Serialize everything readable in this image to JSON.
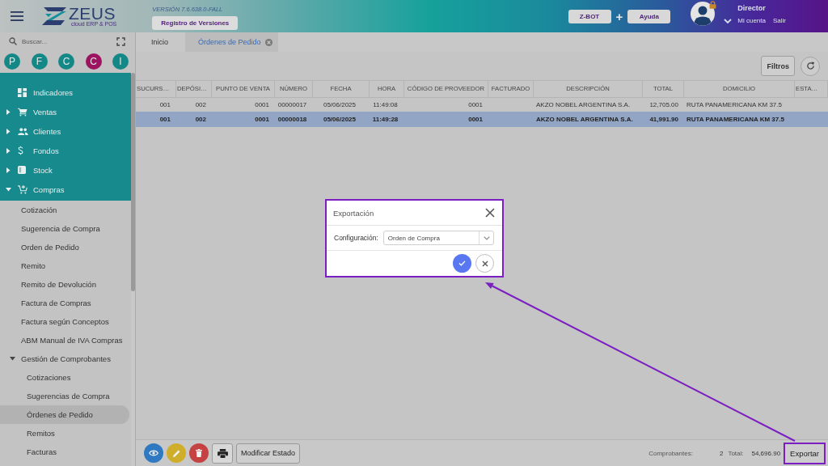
{
  "header": {
    "logo": {
      "name": "ZEUS",
      "tagline": "cloud ERP & POS"
    },
    "version": "VERSIÓN 7.6.638.0-FALL",
    "changelog_button": "Registro de Versiones",
    "zbot_button": "Z-BOT",
    "plus": "+",
    "help_button": "Ayuda",
    "user": {
      "role": "Director",
      "account_link": "Mi cuenta",
      "logout_link": "Salir"
    }
  },
  "sidebar": {
    "search": {
      "placeholder": "Buscar..."
    },
    "shortcuts": [
      {
        "letter": "P",
        "color": "#148886"
      },
      {
        "letter": "F",
        "color": "#148886"
      },
      {
        "letter": "C",
        "color": "#148886"
      },
      {
        "letter": "C",
        "color": "#9c1460"
      },
      {
        "letter": "I",
        "color": "#148886"
      }
    ],
    "menu": [
      {
        "label": "Indicadores",
        "kind": "link"
      },
      {
        "label": "Ventas",
        "kind": "group",
        "expanded": false
      },
      {
        "label": "Clientes",
        "kind": "group",
        "expanded": false
      },
      {
        "label": "Fondos",
        "kind": "group",
        "expanded": false
      },
      {
        "label": "Stock",
        "kind": "group",
        "expanded": false
      },
      {
        "label": "Compras",
        "kind": "group",
        "expanded": true,
        "children": [
          {
            "label": "Cotización",
            "kind": "link",
            "selected": false
          },
          {
            "label": "Sugerencia de Compra",
            "kind": "link",
            "selected": false
          },
          {
            "label": "Orden de Pedido",
            "kind": "link",
            "selected": false
          },
          {
            "label": "Remito",
            "kind": "link",
            "selected": false
          },
          {
            "label": "Remito de Devolución",
            "kind": "link",
            "selected": false
          },
          {
            "label": "Factura de Compras",
            "kind": "link",
            "selected": false
          },
          {
            "label": "Factura según Conceptos",
            "kind": "link",
            "selected": false
          },
          {
            "label": "ABM Manual de IVA Compras",
            "kind": "link",
            "selected": false
          },
          {
            "label": "Gestión de Comprobantes",
            "kind": "group",
            "expanded": true,
            "selected": false,
            "children": [
              {
                "label": "Cotizaciones",
                "selected": false
              },
              {
                "label": "Sugerencias de Compra",
                "selected": false
              },
              {
                "label": "Órdenes de Pedido",
                "selected": true
              },
              {
                "label": "Remitos",
                "selected": false
              },
              {
                "label": "Facturas",
                "selected": false
              }
            ]
          }
        ]
      }
    ]
  },
  "tabs": [
    {
      "label": "Inicio",
      "selected": false,
      "closable": false
    },
    {
      "label": "Órdenes de Pedido",
      "selected": true,
      "closable": true
    }
  ],
  "toolbar": {
    "filter_button": "Filtros"
  },
  "table": {
    "columns": [
      "SUCURS…",
      "DEPÓSI…",
      "PUNTO DE VENTA",
      "NÚMERO",
      "FECHA",
      "HORA",
      "CÓDIGO DE PROVEEDOR",
      "FACTURADO",
      "DESCRIPCIÓN",
      "TOTAL",
      "DOMICILIO",
      "ESTA…"
    ],
    "rows": [
      {
        "selected": false,
        "cells": [
          "001",
          "002",
          "0001",
          "00000017",
          "05/06/2025",
          "11:49:08",
          "0001",
          null,
          "AKZO NOBEL ARGENTINA S.A.",
          "12,705.00",
          "RUTA PANAMERICANA KM 37.5",
          null
        ]
      },
      {
        "selected": true,
        "cells": [
          "001",
          "002",
          "0001",
          "00000018",
          "05/06/2025",
          "11:49:28",
          "0001",
          null,
          "AKZO NOBEL ARGENTINA S.A.",
          "41,991.90",
          "RUTA PANAMERICANA KM 37.5",
          null
        ]
      }
    ]
  },
  "footer": {
    "action_buttons": [
      {
        "kind": "round",
        "color": "#2f78c2"
      },
      {
        "kind": "round",
        "color": "#cfae2c"
      },
      {
        "kind": "round",
        "color": "#c64242"
      },
      {
        "kind": "square",
        "color": "#d8d8d8"
      }
    ],
    "status_button": "Modificar Estado",
    "count_label": "Comprobantes:",
    "count": "2",
    "total_label": "Total:",
    "total": "54,696.90",
    "export_button": {
      "label": "Exportar",
      "highlighted": true
    }
  },
  "dialog": {
    "title": "Exportación",
    "highlighted": true,
    "field": {
      "label": "Configuración:",
      "value": "Orden de Compra"
    }
  }
}
